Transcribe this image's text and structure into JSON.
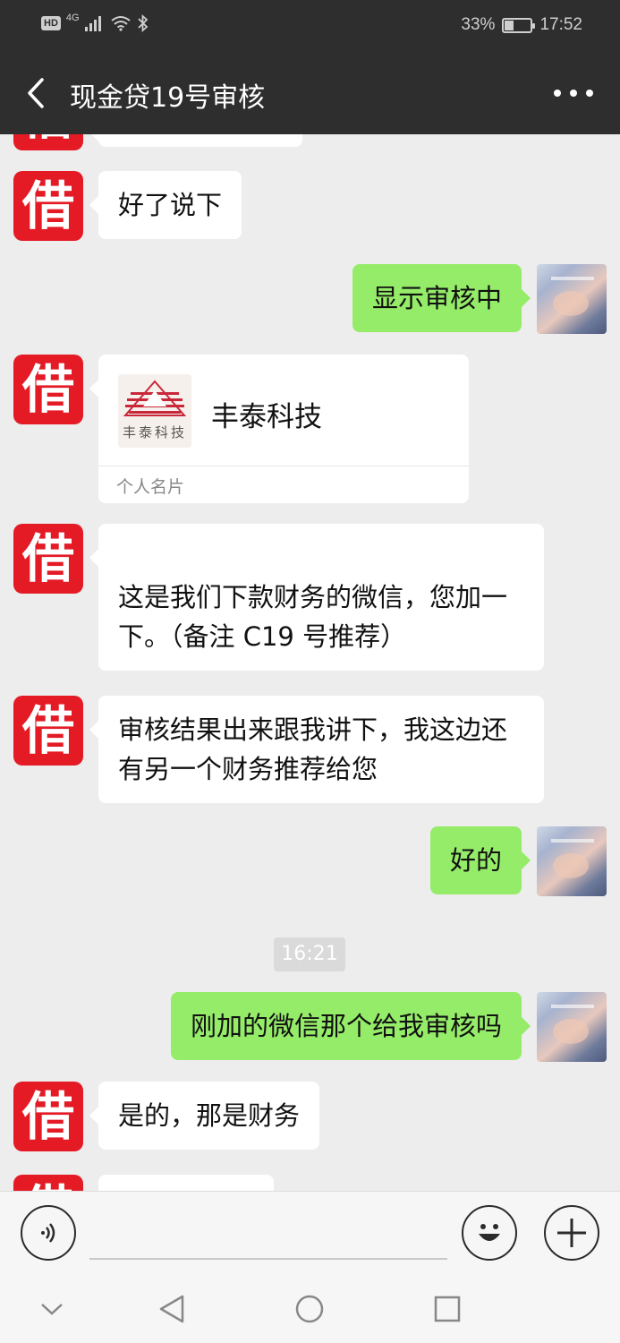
{
  "status_bar": {
    "hd_badge": "HD",
    "network": "4G",
    "battery_text": "33%",
    "battery_level": 0.33,
    "time": "17:52"
  },
  "header": {
    "title": "现金贷19号审核"
  },
  "contact_avatar_char": "借",
  "messages": [
    {
      "from": "them",
      "text": "好了说下"
    },
    {
      "from": "me",
      "text": "显示审核中"
    },
    {
      "from": "them",
      "type": "contact_card",
      "name": "丰泰科技",
      "logo_text": "丰泰科技",
      "card_type": "个人名片"
    },
    {
      "from": "them",
      "line1": "这是我们下款财务的微信，您加一",
      "line2": "下。（备注 C19 号推荐）"
    },
    {
      "from": "them",
      "line1": "审核结果出来跟我讲下，我这边还",
      "line2": "有另一个财务推荐给您"
    },
    {
      "from": "me",
      "text": "好的"
    },
    {
      "type": "timestamp",
      "text": "16:21"
    },
    {
      "from": "me",
      "text": "刚加的微信那个给我审核吗"
    },
    {
      "from": "them",
      "text": "是的，那是财务"
    }
  ],
  "icons": {
    "voice": "voice-icon",
    "emoji": "emoji-icon",
    "add": "plus-icon",
    "back": "back-arrow-icon",
    "more": "more-icon"
  },
  "colors": {
    "header_bg": "#2e2e2e",
    "my_bubble": "#95ec69",
    "their_bubble": "#ffffff",
    "avatar_red": "#e41a25",
    "chat_bg": "#ededed"
  }
}
